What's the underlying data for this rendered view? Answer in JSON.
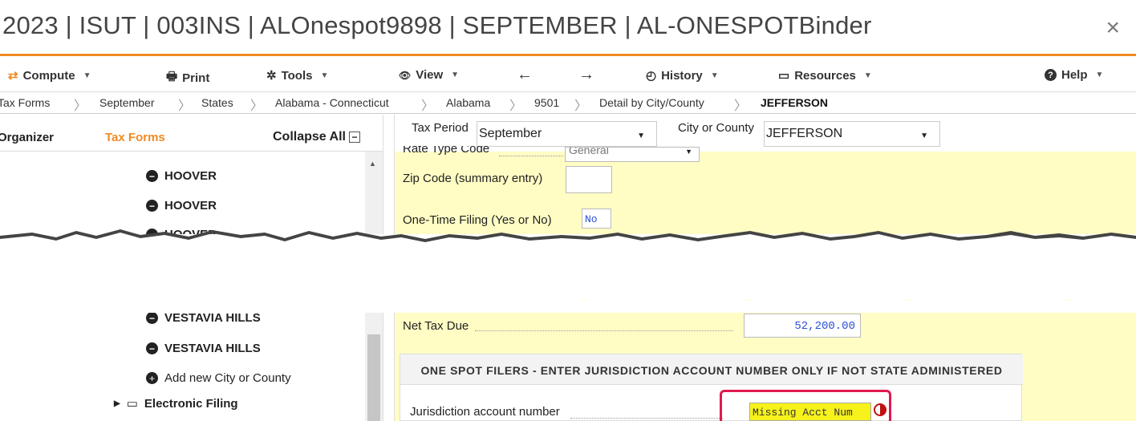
{
  "window": {
    "title": "2023 | ISUT | 003INS | ALOnespot9898 | SEPTEMBER | AL-ONESPOTBinder",
    "close_glyph": "×"
  },
  "toolbar": {
    "compute": "Compute",
    "print": "Print",
    "tools": "Tools",
    "view": "View",
    "back_glyph": "←",
    "forward_glyph": "→",
    "history": "History",
    "resources": "Resources",
    "help": "Help"
  },
  "breadcrumb": [
    "Tax Forms",
    "September",
    "States",
    "Alabama - Connecticut",
    "Alabama",
    "9501",
    "Detail by City/County",
    "JEFFERSON"
  ],
  "left_pane": {
    "organizer_tab": "Organizer",
    "tax_forms_tab": "Tax Forms",
    "collapse_all": "Collapse All",
    "items": [
      "HOOVER",
      "HOOVER",
      "HOOVER",
      "VESTAVIA HILLS",
      "VESTAVIA HILLS"
    ],
    "add_new": "Add new City or County",
    "electronic_filing": "Electronic Filing"
  },
  "form": {
    "tax_period_label": "Tax Period",
    "tax_period_value": "September",
    "city_county_label": "City or County",
    "city_county_value": "JEFFERSON",
    "rate_type_label": "Rate Type Code",
    "rate_type_value": "General",
    "zip_label": "Zip Code (summary entry)",
    "one_time_label": "One-Time Filing (Yes or No)",
    "one_time_value": "No",
    "net_tax_label": "Net Tax Due",
    "net_tax_value": "52,200.00",
    "onespot_header": "ONE SPOT FILERS - ENTER JURISDICTION ACCOUNT NUMBER ONLY IF NOT STATE ADMINISTERED",
    "jurisdiction_label": "Jurisdiction account number",
    "jurisdiction_value": "Missing Acct Num"
  },
  "colors": {
    "accent_orange": "#f08a24",
    "form_background": "#fffdc4",
    "callout_red": "#e0194f",
    "highlight_yellow": "#f7f11c",
    "value_blue": "#2a4fd6"
  }
}
